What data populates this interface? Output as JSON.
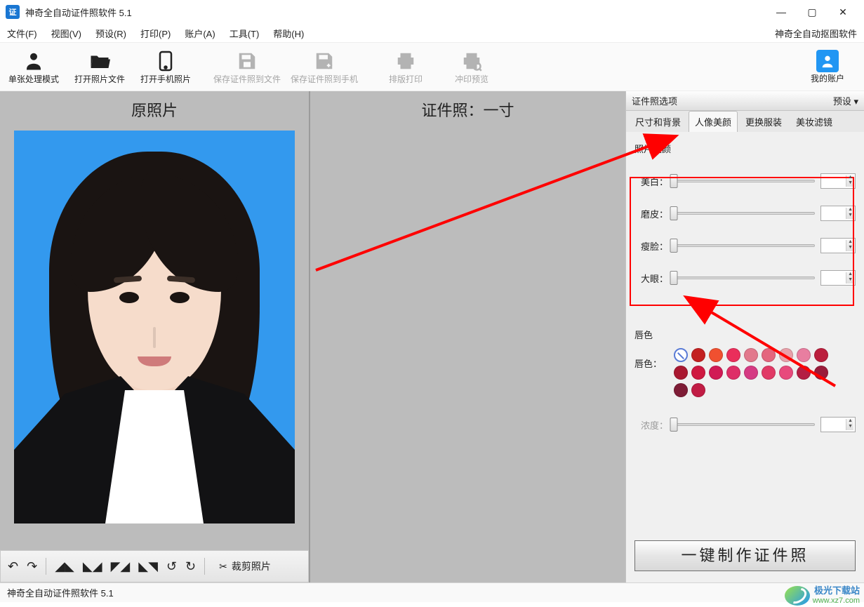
{
  "window": {
    "title": "神奇全自动证件照软件 5.1",
    "logo_text": "证"
  },
  "menubar": {
    "items": [
      "文件(F)",
      "视图(V)",
      "预设(R)",
      "打印(P)",
      "账户(A)",
      "工具(T)",
      "帮助(H)"
    ],
    "right_link": "神奇全自动抠图软件"
  },
  "toolbar": {
    "buttons": [
      {
        "label": "单张处理模式",
        "enabled": true
      },
      {
        "label": "打开照片文件",
        "enabled": true
      },
      {
        "label": "打开手机照片",
        "enabled": true
      },
      {
        "label": "保存证件照到文件",
        "enabled": false
      },
      {
        "label": "保存证件照到手机",
        "enabled": false
      },
      {
        "label": "排版打印",
        "enabled": false
      },
      {
        "label": "冲印预览",
        "enabled": false
      }
    ],
    "account_label": "我的账户"
  },
  "panels": {
    "left_title": "原照片",
    "mid_title": "证件照：一寸",
    "crop_label": "裁剪照片"
  },
  "right": {
    "header": "证件照选项",
    "preset": "预设 ▾",
    "tabs": [
      "尺寸和背景",
      "人像美颜",
      "更换服装",
      "美妆滤镜"
    ],
    "active_tab_index": 1,
    "group_beauty": "照片美颜",
    "sliders": [
      {
        "label": "美白：",
        "value": 0
      },
      {
        "label": "磨皮：",
        "value": 0
      },
      {
        "label": "瘦脸：",
        "value": 0
      },
      {
        "label": "大眼：",
        "value": 0
      }
    ],
    "group_lip": "唇色",
    "lip_label": "唇色：",
    "lip_colors_row1": [
      "none",
      "#c32020",
      "#f05030",
      "#ea2e5b",
      "#e2788c",
      "#e4667e",
      "#e9a0aa",
      "#e87ea0",
      "#bb1f3d",
      "#a91830"
    ],
    "lip_colors_row2": [
      "#cf1840",
      "#d11a55",
      "#de2e67",
      "#d53a83",
      "#e13a66",
      "#e84a7c",
      "#b41e44",
      "#9a1c3b",
      "#7e1c36",
      "#c11c44"
    ],
    "opacity_label": "浓度：",
    "opacity_value": 0,
    "make_button": "一键制作证件照"
  },
  "statusbar": {
    "text": "神奇全自动证件照软件 5.1"
  },
  "watermark": {
    "name": "极光下载站",
    "url": "www.xz7.com"
  }
}
